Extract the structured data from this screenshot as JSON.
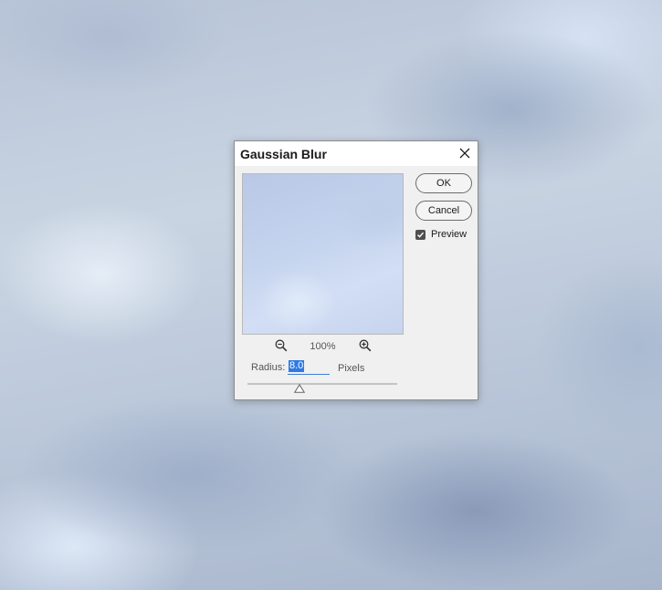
{
  "dialog": {
    "title": "Gaussian Blur",
    "close_icon": "close-icon",
    "buttons": {
      "ok_label": "OK",
      "cancel_label": "Cancel"
    },
    "preview_checkbox": {
      "label": "Preview",
      "checked": true
    },
    "zoom": {
      "level": "100%",
      "zoom_out_icon": "zoom-out-icon",
      "zoom_in_icon": "zoom-in-icon"
    },
    "radius": {
      "label": "Radius:",
      "value": "8.0",
      "unit": "Pixels",
      "slider_level_fraction": 0.35
    }
  },
  "colors": {
    "dialog_bg": "#f0f0f0",
    "selection_highlight": "#2f7ae5",
    "input_underline": "#3c7fd9"
  }
}
